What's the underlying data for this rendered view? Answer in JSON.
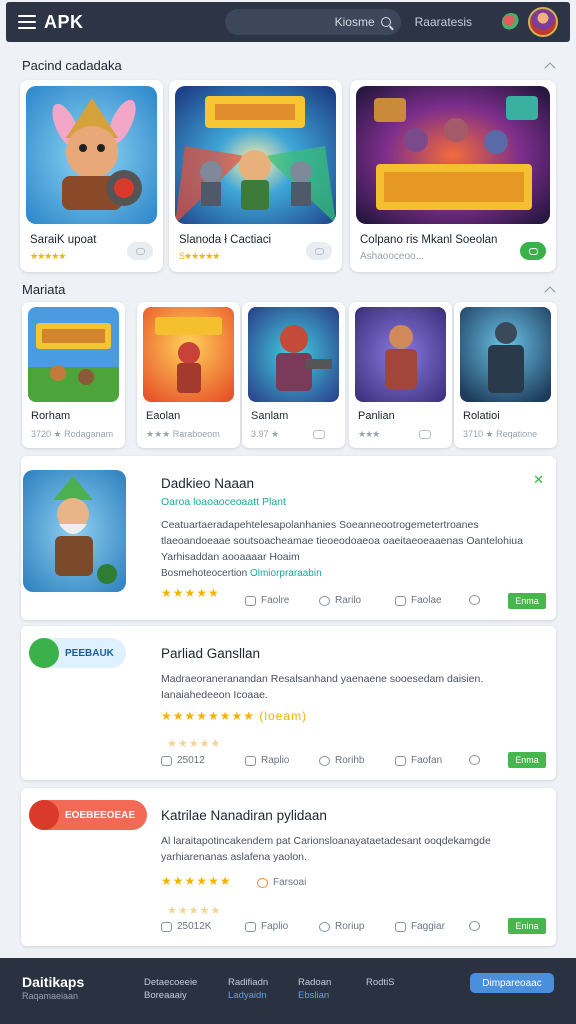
{
  "header": {
    "logo": "APK",
    "search_placeholder": "Kiosme",
    "link": "Raaratesis"
  },
  "sections": {
    "popular_title": "Pacind cadadaka",
    "new_title": "Mariata"
  },
  "featured": [
    {
      "title": "SaraiK upoat",
      "sub": "★★★★★"
    },
    {
      "title": "Slanoda ł Cactiaci",
      "sub": "S★★★★★"
    },
    {
      "title": "Colpano ris Mkanl Soeolan",
      "sub": "Ashaooceoo..."
    }
  ],
  "games": [
    {
      "title": "Rorham",
      "sub": "3720 ★  Rodaganam"
    },
    {
      "title": "Eaolan",
      "sub": "★★★  Raraboeom"
    },
    {
      "title": "Sanlam",
      "sub": "3.97 ★"
    },
    {
      "title": "Panlian",
      "sub": "★★★"
    },
    {
      "title": "Rolatioi",
      "sub": "3710 ★  Reqatione"
    }
  ],
  "details": [
    {
      "title": "Dadkieo Naaan",
      "sub": "Oaroa loaoaoceoaatt Plant",
      "desc": "Ceatuartaeradapehtelesapolanhanies Soeanneootrogemetertroanes tlaeoandoeaae soutsoacheamae tieoeodoaeoa oaeitaeoeaaenas Oantelohiua Yarhisaddan aooaaaar Hoaim",
      "link_prefix": "Bosmehoteocertion",
      "link_teal": "Olmiorpraraabin",
      "stars": "★★★★★",
      "actions": [
        "Faolre",
        "Rarilo",
        "Faolae"
      ],
      "get": "Enma"
    },
    {
      "title": "Parliad Gansllan",
      "badge": "PEEBAUK",
      "desc": "Madraeoraneranandan Resalsanhand yaenaene sooesedam daisien. Ianaiahedeeon Icoaae.",
      "stars": "★★★★★★★★ (loeam)",
      "faint": "★★★★★",
      "rating": "25012",
      "actions": [
        "Raplio",
        "Rorihb",
        "Faofan"
      ],
      "get": "Enma"
    },
    {
      "title": "Katrilae Nanadiran pylidaan",
      "badge": "EOEBEEOEAE",
      "desc": "Al laraitapotincakendem pat Carionsloanayataetadesant ooqdekamgde yarhiarenanas aslafena yaolon.",
      "stars": "★★★★★★",
      "stars_note": "Farsoai",
      "faint": "★★★★★",
      "rating": "25012K",
      "actions": [
        "Faplio",
        "Roriup",
        "Faggiar"
      ],
      "get": "Enina"
    }
  ],
  "footer": {
    "brand": "Daitikaps",
    "brand_sub": "Raqamaeiaan",
    "cols": [
      {
        "a": "Detaecoeeie",
        "b": "Boreaaaiy"
      },
      {
        "a": "Radifiadn",
        "b": "Ladyaidn"
      },
      {
        "a": "Radoan",
        "b": "Ebslian"
      },
      {
        "a": "RodtiS",
        "b": ""
      }
    ],
    "button": "Dimpareoaac"
  },
  "colors": {
    "accent": "#48b64e",
    "header": "#2c3446",
    "teal": "#18a99a",
    "star": "#f3b300"
  }
}
